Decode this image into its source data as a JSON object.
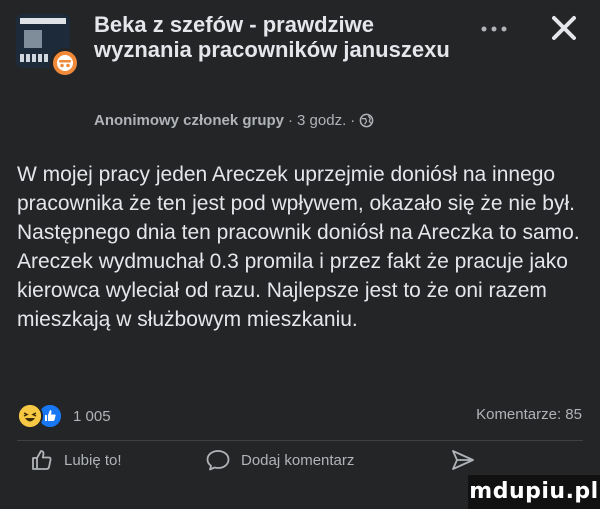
{
  "post": {
    "group_title": "Beka z szefów - prawdziwe wyznania pracowników januszexu",
    "author": "Anonimowy członek grupy",
    "separator": "·",
    "time": "3 godz.",
    "body": "W mojej pracy jeden Areczek uprzejmie doniósł na innego pracownika że ten jest pod wpływem, okazało się że nie był. Następnego dnia ten pracownik doniósł na Areczka to samo. Areczek wydmuchał 0.3 promila i przez fakt że pracuje jako kierowca wyleciał od razu. Najlepsze jest to że oni razem mieszkają w służbowym mieszkaniu.",
    "reactions_count": "1 005",
    "comments_label": "Komentarze: 85",
    "icons": [
      "anonymous-icon",
      "globe-icon",
      "more-icon",
      "close-icon",
      "haha-reaction-icon",
      "like-reaction-icon",
      "thumbs-up-icon",
      "comment-icon",
      "share-icon"
    ]
  },
  "actions": {
    "like": "Lubię to!",
    "comment": "Dodaj komentarz"
  },
  "watermark": "mdupiu.pl",
  "colors": {
    "background": "#242526",
    "text": "#e4e6eb",
    "secondary": "#b0b3b8",
    "like_blue": "#1877f2",
    "haha_yellow": "#f7c843"
  }
}
